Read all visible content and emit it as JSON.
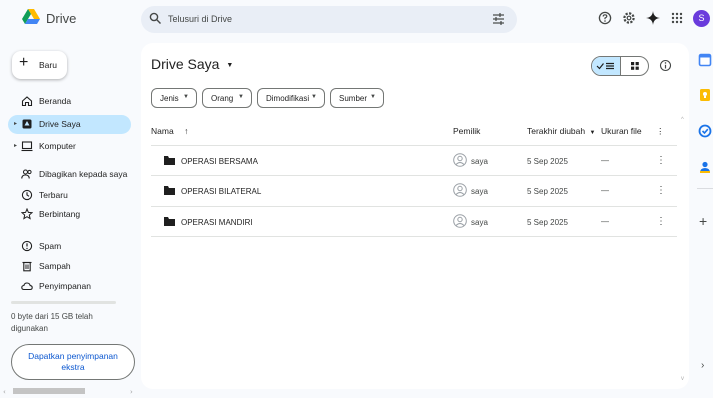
{
  "header": {
    "app_name": "Drive",
    "search_placeholder": "Telusuri di Drive",
    "avatar_letter": "S"
  },
  "new_button": {
    "plus": "+",
    "label": "Baru"
  },
  "sidebar": {
    "items": [
      {
        "label": "Beranda",
        "icon": "home-icon"
      },
      {
        "label": "Drive Saya",
        "icon": "my-drive-icon",
        "active": true
      },
      {
        "label": "Komputer",
        "icon": "computer-icon"
      },
      {
        "label": "Dibagikan kepada saya",
        "icon": "shared-icon"
      },
      {
        "label": "Terbaru",
        "icon": "clock-icon"
      },
      {
        "label": "Berbintang",
        "icon": "star-icon"
      },
      {
        "label": "Spam",
        "icon": "spam-icon"
      },
      {
        "label": "Sampah",
        "icon": "trash-icon"
      },
      {
        "label": "Penyimpanan",
        "icon": "cloud-icon"
      }
    ],
    "storage_text": "0 byte dari 15 GB telah digunakan",
    "get_storage_label": "Dapatkan penyimpanan ekstra"
  },
  "main": {
    "title": "Drive Saya",
    "filters": [
      "Jenis",
      "Orang",
      "Dimodifikasi",
      "Sumber"
    ],
    "columns": {
      "name": "Nama",
      "owner": "Pemilik",
      "modified": "Terakhir diubah",
      "size": "Ukuran file"
    },
    "rows": [
      {
        "name": "OPERASI BERSAMA",
        "owner": "saya",
        "modified": "5 Sep 2025",
        "size": "—"
      },
      {
        "name": "OPERASI BILATERAL",
        "owner": "saya",
        "modified": "5 Sep 2025",
        "size": "—"
      },
      {
        "name": "OPERASI MANDIRI",
        "owner": "saya",
        "modified": "5 Sep 2025",
        "size": "—"
      }
    ]
  },
  "colors": {
    "accent": "#0b57d0",
    "active_bg": "#c2e7ff",
    "search_bg": "#e9eef6",
    "avatar_bg": "#6a3bdc"
  }
}
